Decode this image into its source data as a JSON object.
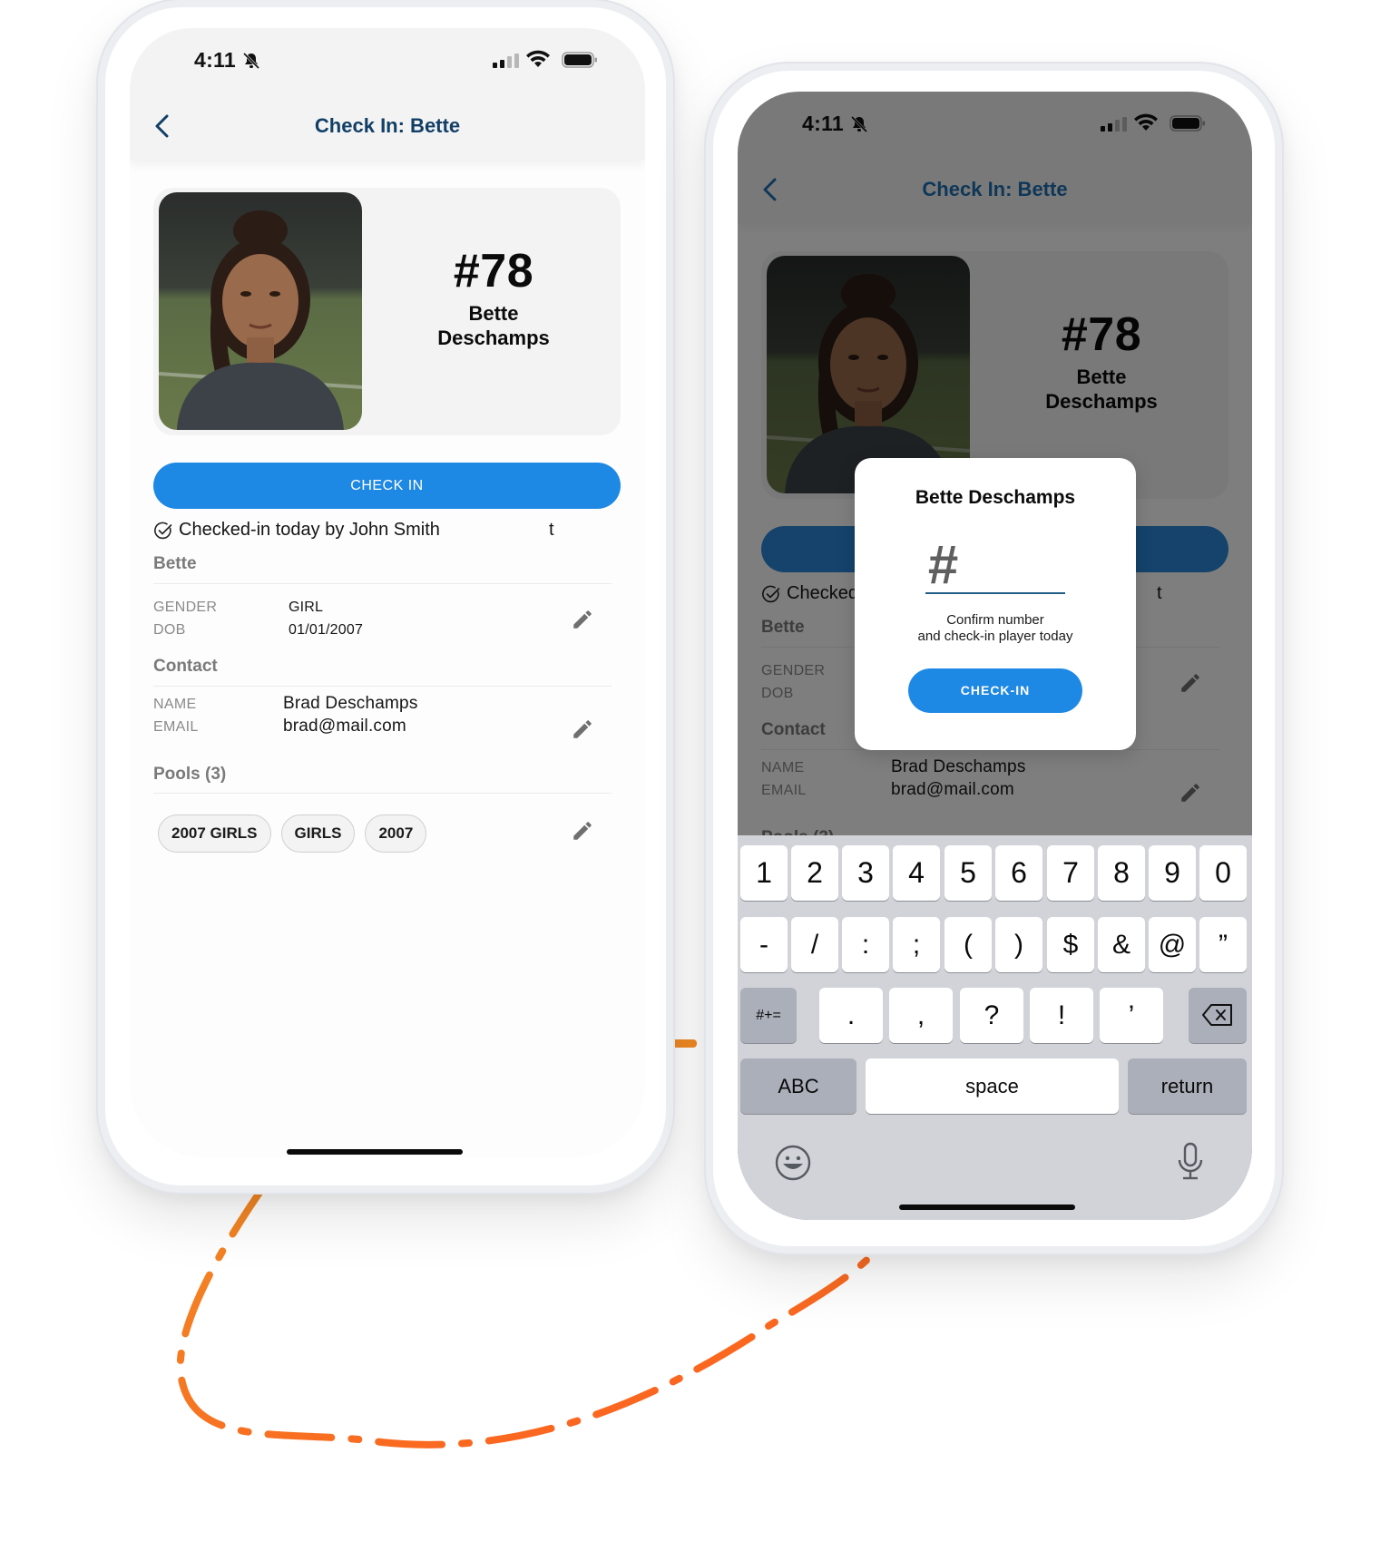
{
  "colors": {
    "primary": "#1e88e5",
    "nav_title": "#123f66",
    "connector_start": "#f08a24",
    "connector_end": "#ff5a1f"
  },
  "status_bar": {
    "time": "4:11",
    "signal_bars_filled": 2,
    "signal_bars_total": 4
  },
  "header": {
    "title": "Check In: Bette"
  },
  "player": {
    "number": "#78",
    "first_name": "Bette",
    "last_name": "Deschamps",
    "photo_alt": "Player photo"
  },
  "check_in_button_label": "CHECK IN",
  "checked_in_status": "Checked-in today by John Smith",
  "checked_in_stray_char": "t",
  "sections": {
    "player": {
      "title": "Bette",
      "fields": [
        {
          "label": "GENDER",
          "value": "GIRL"
        },
        {
          "label": "DOB",
          "value": "01/01/2007"
        }
      ]
    },
    "contact": {
      "title": "Contact",
      "fields": [
        {
          "label": "NAME",
          "value": "Brad Deschamps"
        },
        {
          "label": "EMAIL",
          "value": "brad@mail.com"
        }
      ]
    },
    "pools": {
      "title": "Pools (3)",
      "chips": [
        "2007 GIRLS",
        "GIRLS",
        "2007"
      ]
    }
  },
  "modal": {
    "title": "Bette Deschamps",
    "input_placeholder": "#",
    "input_value": "",
    "description_line1": "Confirm number",
    "description_line2": "and check-in player today",
    "button_label": "CHECK-IN"
  },
  "keyboard": {
    "row1": [
      "1",
      "2",
      "3",
      "4",
      "5",
      "6",
      "7",
      "8",
      "9",
      "0"
    ],
    "row2": [
      "-",
      "/",
      ":",
      ";",
      "(",
      ")",
      "$",
      "&",
      "@",
      "”"
    ],
    "row3_left": "#+=",
    "row3": [
      ".",
      ",",
      "?",
      "!",
      "’"
    ],
    "row4": {
      "left": "ABC",
      "space": "space",
      "right": "return"
    }
  }
}
